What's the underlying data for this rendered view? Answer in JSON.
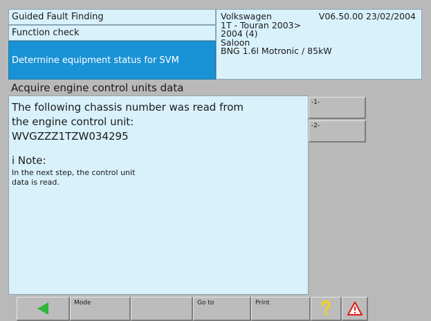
{
  "header": {
    "row1": "Guided Fault Finding",
    "row2": "Function check",
    "row3": "Determine equipment status for SVM"
  },
  "vehicle": {
    "make": "Volkswagen",
    "version": "V06.50.00 23/02/2004",
    "model_line": "1T - Touran 2003>",
    "year": "2004 (4)",
    "body": "Saloon",
    "engine": "BNG 1.6l Motronic / 85kW"
  },
  "title": "Acquire engine control units data",
  "content": {
    "line1": "The following chassis number was read from",
    "line2": "the engine control unit:",
    "vin": "WVGZZZ1TZW034295",
    "note_heading": "i Note:",
    "note_line1": "In the next step, the control unit",
    "note_line2": "data is read."
  },
  "side_buttons": [
    "-1-",
    "-2-"
  ],
  "toolbar": {
    "mode_label": "Mode",
    "goto_label": "Go to",
    "print_label": "Print"
  },
  "colors": {
    "panel_bg": "#d9f1fb",
    "highlight": "#1a92d6",
    "back_arrow": "#2fb53a",
    "help_icon": "#f2d21b",
    "warning_icon": "#e02020"
  },
  "icons": {
    "back": "back-arrow-icon",
    "help": "help-question-icon",
    "warning": "warning-triangle-icon"
  }
}
